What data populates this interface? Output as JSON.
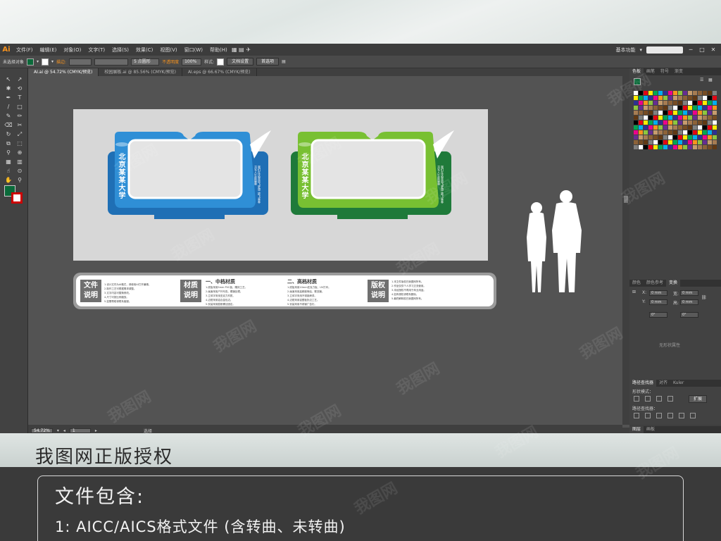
{
  "app": {
    "logo": "Ai"
  },
  "menu": {
    "items": [
      "文件(F)",
      "编辑(E)",
      "对象(O)",
      "文字(T)",
      "选择(S)",
      "效果(C)",
      "视图(V)",
      "窗口(W)",
      "帮助(H)"
    ],
    "workspace": "基本功能"
  },
  "control": {
    "selection": "未选择对象",
    "stroke_label": "描边:",
    "brush": "5 点圆形",
    "opacity_label": "不透明度",
    "opacity": "100%",
    "style_label": "样式:",
    "doc_setup": "文档设置",
    "prefs": "首选项"
  },
  "tabs": [
    {
      "label": "AI.ai @ 54.72% (CMYK/预览)"
    },
    {
      "label": "校园展板.ai @ 85.56% (CMYK/预览)"
    },
    {
      "label": "AI.eps @ 66.67% (CMYK/预览)"
    }
  ],
  "status": {
    "zoom": "54.72%",
    "page": "1",
    "tool": "选择"
  },
  "colors": {
    "frame1": "#2f8fd6",
    "frame1_dark": "#1f6fb5",
    "frame2": "#78c032",
    "frame2_dark": "#1f7a3a",
    "accent": "#f7931e"
  },
  "artboard": {
    "frame1": {
      "school": "北京某某大学",
      "sub": "我们在这里放飞梦想 放飞青春 书写人生新篇章"
    },
    "frame2": {
      "school": "北京某某大学",
      "sub": "我们在这里放飞梦想 放飞青春 书写人生新篇章"
    }
  },
  "strip": {
    "label1": [
      "文件",
      "说明"
    ],
    "label2": [
      "材质",
      "说明"
    ],
    "label3": [
      "版权",
      "说明"
    ],
    "head1": "一、中档材质",
    "head2": "二、高档材质",
    "lines1": [
      "1.设计文件为AI格式，请使用AI打开编辑。",
      "2.制作工艺可根据需求调整。",
      "3.文字内容可替换修改。",
      "4.尺寸可按比例缩放。",
      "5.如需帮助请联系客服。"
    ],
    "lines2": [
      "1.底板采用5mm PVC板，雕刻工艺。",
      "2.画面采用户外写真，覆膜处理。",
      "3.立体字采用亚克力材质。",
      "4.边框采用铝合金包边。",
      "5.安装采用膨胀螺丝固定。"
    ],
    "lines3": [
      "1.底板采用10mm亚克力板，UV打印。",
      "2.画面采用高精度喷绘，覆亚膜。",
      "3.立体字采用不锈钢烤漆。",
      "4.边框采用铝塑板折边工艺。",
      "5.安装采用不锈钢广告钉。"
    ],
    "lines4": [
      "1.本文件版权归我图网所有。",
      "2.作品仅供个人学习交流使用。",
      "3.未经授权不得用于商业用途。",
      "4.如有侵权请联系删除。",
      "5.最终解释权归我图网所有。"
    ]
  },
  "panels": {
    "swatch_tabs": [
      "色板",
      "画笔",
      "符号",
      "渐变"
    ],
    "transform_tabs": [
      "颜色",
      "颜色参考",
      "变换"
    ],
    "x_label": "X:",
    "y_label": "Y:",
    "w_label": "宽:",
    "h_label": "高:",
    "x": "0 mm",
    "y": "0 mm",
    "w": "0 mm",
    "h": "0 mm",
    "angle": "0°",
    "shear": "0°",
    "no_shape": "无形状属性",
    "pathfinder_tabs": [
      "路径查找器",
      "对齐",
      "Kuler"
    ],
    "shape_modes": "形状模式：",
    "pathfinders": "路径查找器：",
    "expand": "扩展",
    "layer_tabs": [
      "图层",
      "画板"
    ]
  },
  "promo": {
    "cut_text": "我图网正版授权"
  },
  "info": {
    "title": "文件包含:",
    "line1": "1: AICC/AICS格式文件 (含转曲、未转曲)"
  },
  "watermark": "我图网"
}
